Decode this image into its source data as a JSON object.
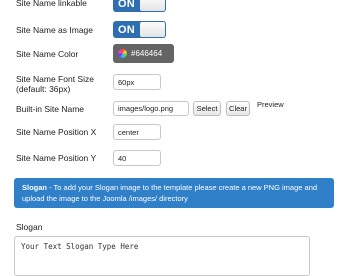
{
  "fields": {
    "linkable": {
      "label": "Site Name linkable",
      "state": "ON"
    },
    "as_image": {
      "label": "Site Name as Image",
      "state": "ON"
    },
    "color": {
      "label": "Site Name Color",
      "value": "#646464"
    },
    "font_size": {
      "label_line1": "Site Name Font Size",
      "label_line2": "(default: 36px)",
      "value": "60px"
    },
    "builtin": {
      "label": "Built-in Site Name",
      "value": "images/logo.png",
      "select_label": "Select",
      "clear_label": "Clear",
      "preview_label": "Preview"
    },
    "pos_x": {
      "label": "Site Name Position X",
      "value": "center"
    },
    "pos_y": {
      "label": "Site Name Position Y",
      "value": "40"
    }
  },
  "alert": {
    "title": "Slogan",
    "text": " - To add your Slogan image to the template please create a new PNG image and upload the image to the Joomla /images/ directory"
  },
  "slogan": {
    "label": "Slogan",
    "value": "Your Text Slogan Type Here"
  },
  "colors": {
    "toggle_bg": "#2d6fb0",
    "alert_bg": "#2f7fc9",
    "chip_bg": "#646464"
  }
}
